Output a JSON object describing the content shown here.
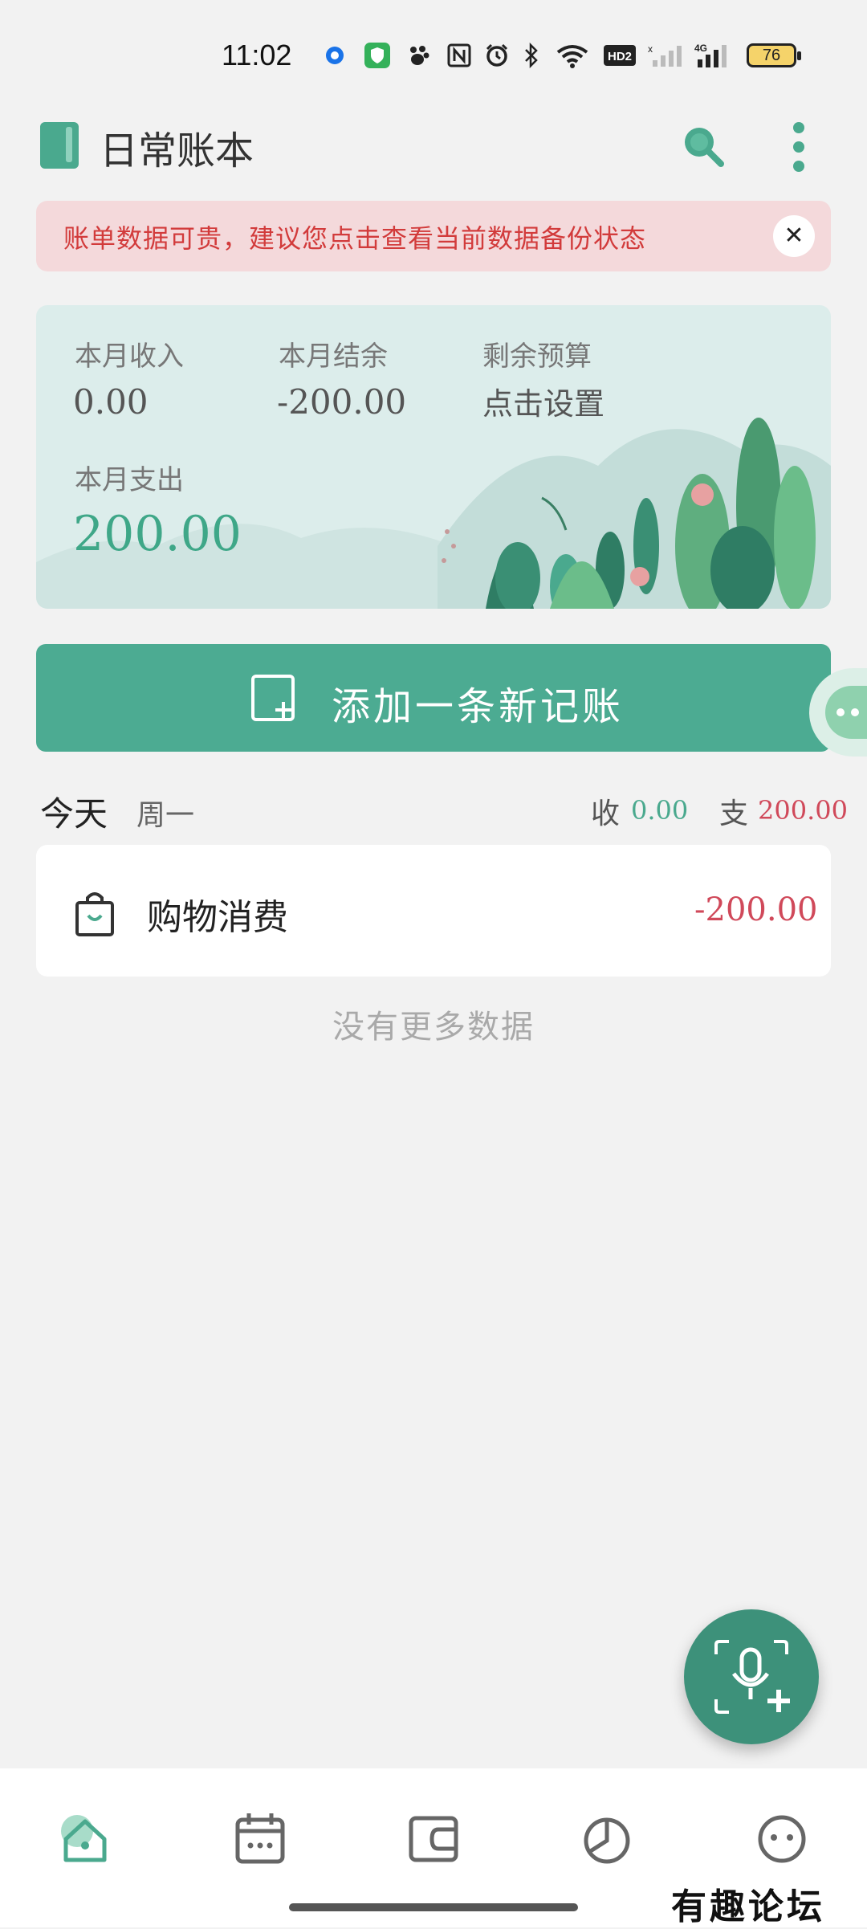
{
  "status_bar": {
    "time": "11:02",
    "battery": "76",
    "icons": [
      "app-icon",
      "shield-icon",
      "paw-icon",
      "nfc-icon",
      "alarm-icon",
      "bluetooth-icon",
      "wifi-icon",
      "hd-icon",
      "signal-icon",
      "4g-signal-icon"
    ]
  },
  "header": {
    "title": "日常账本"
  },
  "alert": {
    "text": "账单数据可贵，建议您点击查看当前数据备份状态",
    "close_glyph": "✕"
  },
  "summary": {
    "income_label": "本月收入",
    "income_value": "0.00",
    "balance_label": "本月结余",
    "balance_value": "-200.00",
    "budget_label": "剩余预算",
    "budget_value": "点击设置",
    "expense_label": "本月支出",
    "expense_value": "200.00"
  },
  "add_button": {
    "label": "添加一条新记账"
  },
  "day_group": {
    "day": "今天",
    "weekday": "周一",
    "income_label": "收",
    "income_value": "0.00",
    "expense_label": "支",
    "expense_value": "200.00"
  },
  "records": [
    {
      "name": "购物消费",
      "amount": "-200.00",
      "icon": "shopping-bag-icon"
    }
  ],
  "no_more_text": "没有更多数据",
  "bottom_nav": [
    {
      "icon": "home-icon",
      "active": true
    },
    {
      "icon": "calendar-icon",
      "active": false
    },
    {
      "icon": "wallet-icon",
      "active": false
    },
    {
      "icon": "pie-chart-icon",
      "active": false
    },
    {
      "icon": "profile-icon",
      "active": false
    }
  ],
  "watermark": "有趣论坛",
  "colors": {
    "accent": "#4cab92",
    "expense": "#d0495a",
    "alert_bg": "#f4d9db",
    "alert_text": "#d23b3b"
  }
}
